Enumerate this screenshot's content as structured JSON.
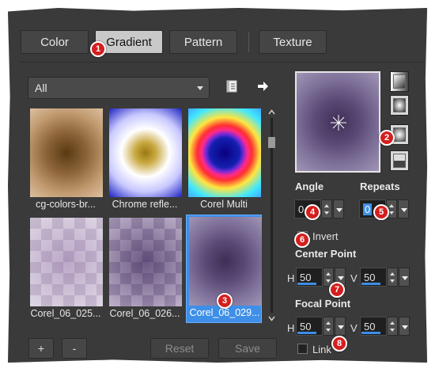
{
  "tabs": [
    {
      "label": "Color"
    },
    {
      "label": "Gradient"
    },
    {
      "label": "Pattern"
    },
    {
      "label": "Texture"
    }
  ],
  "filter": {
    "selected": "All"
  },
  "swatches": [
    {
      "label": "cg-colors-br..."
    },
    {
      "label": "Chrome refle..."
    },
    {
      "label": "Corel Multi"
    },
    {
      "label": "Corel_06_025..."
    },
    {
      "label": "Corel_06_026..."
    },
    {
      "label": "Corel_06_029..."
    }
  ],
  "buttons": {
    "add": "+",
    "remove": "-",
    "reset": "Reset",
    "save": "Save"
  },
  "angle": {
    "label": "Angle",
    "value": "0"
  },
  "repeats": {
    "label": "Repeats",
    "value": "0"
  },
  "invert": {
    "label": "Invert"
  },
  "center_point": {
    "label": "Center Point",
    "h_label": "H",
    "h_value": "50",
    "v_label": "V",
    "v_value": "50"
  },
  "focal_point": {
    "label": "Focal Point",
    "h_label": "H",
    "h_value": "50",
    "v_label": "V",
    "v_value": "50"
  },
  "link": {
    "label": "Link"
  },
  "badges": [
    "1",
    "2",
    "3",
    "4",
    "5",
    "6",
    "7",
    "8"
  ],
  "colors": {
    "accent": "#3e8fe8",
    "badge": "#d41f1f"
  }
}
